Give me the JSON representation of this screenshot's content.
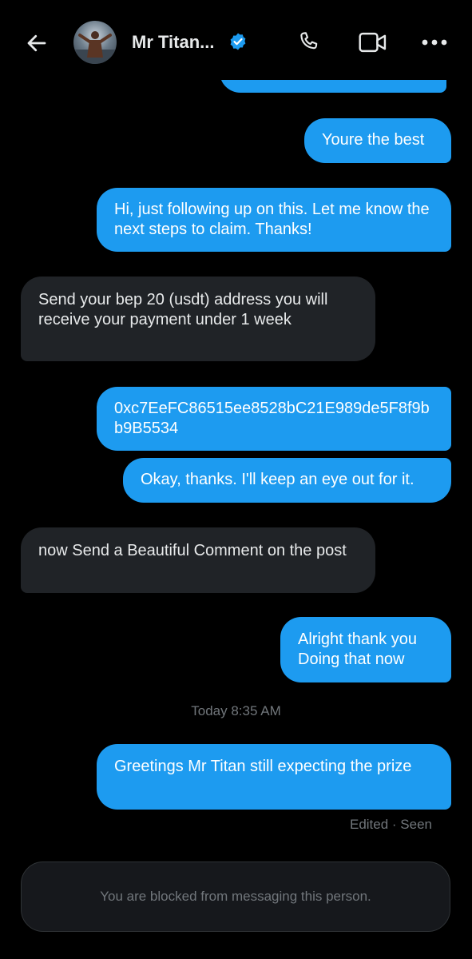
{
  "header": {
    "contact_name": "Mr Titan...",
    "back_icon": "arrow-left-icon",
    "verified_icon": "verified-badge-icon",
    "call_icon": "phone-icon",
    "video_icon": "video-camera-icon",
    "more_icon": "more-horizontal-icon"
  },
  "messages": [
    {
      "direction": "outgoing",
      "text": ""
    },
    {
      "direction": "outgoing",
      "text": "Youre the best"
    },
    {
      "direction": "outgoing",
      "text": "Hi, just following up on this. Let me know the next steps to claim. Thanks!"
    },
    {
      "direction": "incoming",
      "text": "Send your bep 20 (usdt)  address you will receive your payment under 1 week"
    },
    {
      "direction": "outgoing",
      "text": "0xc7EeFC86515ee8528bC21E989de5F8f9bb9B5534"
    },
    {
      "direction": "outgoing",
      "text": "Okay, thanks. I'll keep an eye out for it."
    },
    {
      "direction": "incoming",
      "text": "now Send a Beautiful Comment on the post"
    },
    {
      "direction": "outgoing",
      "text": "Alright thank you Doing that now"
    },
    {
      "direction": "outgoing",
      "text": "Greetings Mr Titan still expecting the prize"
    }
  ],
  "timestamp": "Today 8:35 AM",
  "message_status": "Edited · Seen",
  "blocked_notice": "You are blocked from messaging this person.",
  "colors": {
    "background": "#000000",
    "outgoing_bubble": "#1d9bf0",
    "incoming_bubble": "#202327",
    "muted_text": "#71767b",
    "verified_badge": "#1d9bf0"
  }
}
